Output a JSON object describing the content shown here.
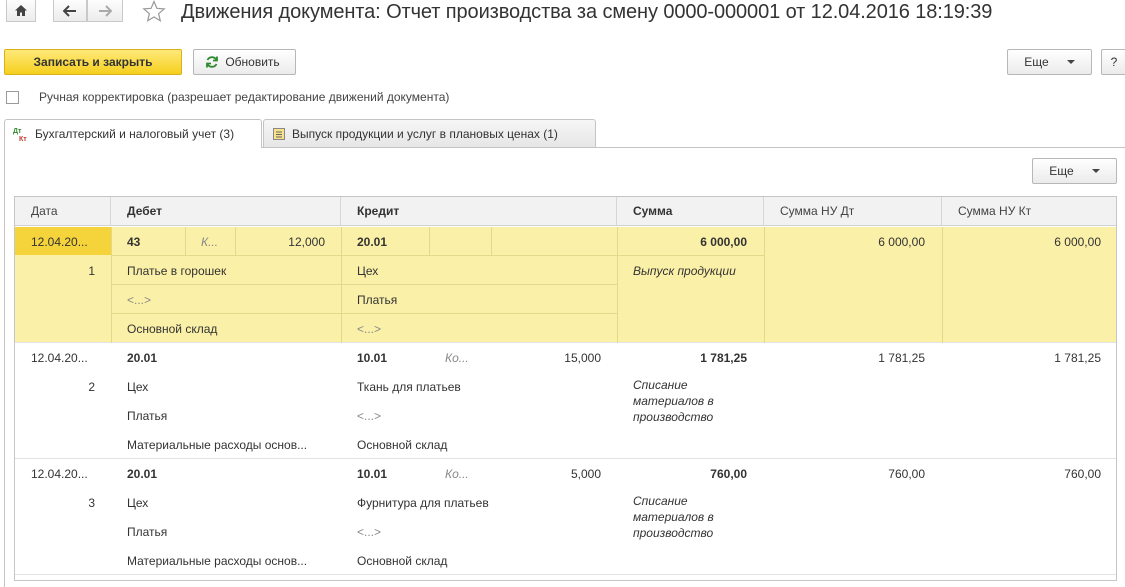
{
  "window": {
    "title": "Движения документа: Отчет производства за смену 0000-000001 от 12.04.2016 18:19:39"
  },
  "toolbar": {
    "save_close_label": "Записать и закрыть",
    "refresh_label": "Обновить",
    "more_label": "Еще",
    "help_label": "?"
  },
  "manual": {
    "label": "Ручная корректировка (разрешает редактирование движений документа)",
    "checked": false
  },
  "tabs": [
    {
      "label": "Бухгалтерский и налоговый учет (3)",
      "active": true
    },
    {
      "label": "Выпуск продукции и услуг в плановых ценах (1)",
      "active": false
    }
  ],
  "table_toolbar": {
    "more_label": "Еще"
  },
  "table": {
    "headers": [
      "Дата",
      "Дебет",
      "Кредит",
      "Сумма",
      "Сумма НУ Дт",
      "Сумма НУ Кт"
    ],
    "rows": [
      {
        "date": "12.04.20...",
        "num": "1",
        "dt_account": "43",
        "dt_qty_label": "К...",
        "dt_qty": "12,000",
        "dt_sub": [
          "Платье в горошек",
          "<...>",
          "Основной склад"
        ],
        "kt_account": "20.01",
        "kt_qty_label": "",
        "kt_qty": "",
        "kt_sub": [
          "Цех",
          "Платья",
          "<...>"
        ],
        "sum": "6 000,00",
        "content": "Выпуск продукции",
        "sum_nu_dt": "6 000,00",
        "sum_nu_kt": "6 000,00"
      },
      {
        "date": "12.04.20...",
        "num": "2",
        "dt_account": "20.01",
        "dt_qty_label": "",
        "dt_qty": "",
        "dt_sub": [
          "Цех",
          "Платья",
          "Материальные расходы основ..."
        ],
        "kt_account": "10.01",
        "kt_qty_label": "Ко...",
        "kt_qty": "15,000",
        "kt_sub": [
          "Ткань для платьев",
          "<...>",
          "Основной склад"
        ],
        "sum": "1 781,25",
        "content": "Списание материалов в производство",
        "sum_nu_dt": "1 781,25",
        "sum_nu_kt": "1 781,25"
      },
      {
        "date": "12.04.20...",
        "num": "3",
        "dt_account": "20.01",
        "dt_qty_label": "",
        "dt_qty": "",
        "dt_sub": [
          "Цех",
          "Платья",
          "Материальные расходы основ..."
        ],
        "kt_account": "10.01",
        "kt_qty_label": "Ко...",
        "kt_qty": "5,000",
        "kt_sub": [
          "Фурнитура для платьев",
          "<...>",
          "Основной склад"
        ],
        "sum": "760,00",
        "content": "Списание материалов в производство",
        "sum_nu_dt": "760,00",
        "sum_nu_kt": "760,00"
      }
    ]
  },
  "colors": {
    "selected_row": "#fbf0a8",
    "primary_button": "#f5cf1e"
  }
}
